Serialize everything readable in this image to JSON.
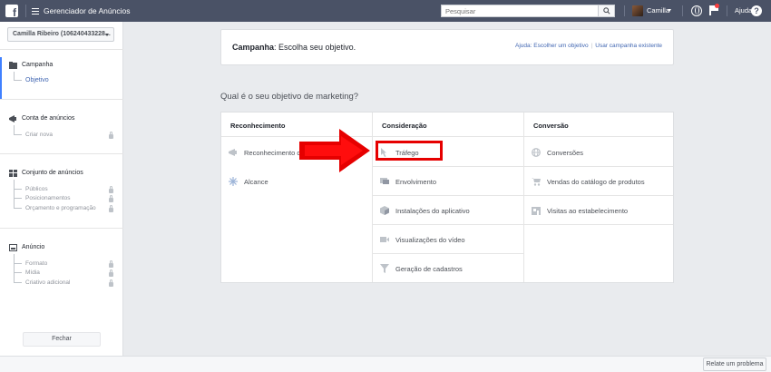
{
  "topbar": {
    "app_title": "Gerenciador de Anúncios",
    "search_placeholder": "Pesquisar",
    "username": "Camilla",
    "help_label": "Ajuda"
  },
  "sidebar": {
    "account": "Camilla Ribeiro (106240433228...",
    "campaign": {
      "title": "Campanha",
      "items": [
        "Objetivo"
      ]
    },
    "ad_account": {
      "title": "Conta de anúncios",
      "items": [
        "Criar nova"
      ]
    },
    "ad_set": {
      "title": "Conjunto de anúncios",
      "items": [
        "Públicos",
        "Posicionamentos",
        "Orçamento e programação"
      ]
    },
    "ad": {
      "title": "Anúncio",
      "items": [
        "Formato",
        "Mídia",
        "Criativo adicional"
      ]
    },
    "close_label": "Fechar"
  },
  "header": {
    "title_bold": "Campanha",
    "title_rest": ": Escolha seu objetivo.",
    "help_link": "Ajuda: Escolher um objetivo",
    "existing_link": "Usar campanha existente"
  },
  "question": "Qual é o seu objetivo de marketing?",
  "columns": [
    {
      "title": "Reconhecimento",
      "items": [
        {
          "label": "Reconhecimento d",
          "icon": "megaphone-icon"
        },
        {
          "label": "Alcance",
          "icon": "burst-icon"
        }
      ]
    },
    {
      "title": "Consideração",
      "items": [
        {
          "label": "Tráfego",
          "icon": "cursor-icon"
        },
        {
          "label": "Envolvimento",
          "icon": "chat-icon"
        },
        {
          "label": "Instalações do aplicativo",
          "icon": "box-icon"
        },
        {
          "label": "Visualizações do vídeo",
          "icon": "video-icon"
        },
        {
          "label": "Geração de cadastros",
          "icon": "funnel-icon"
        }
      ]
    },
    {
      "title": "Conversão",
      "items": [
        {
          "label": "Conversões",
          "icon": "globe-icon"
        },
        {
          "label": "Vendas do catálogo de produtos",
          "icon": "cart-icon"
        },
        {
          "label": "Visitas ao estabelecimento",
          "icon": "store-icon"
        }
      ]
    }
  ],
  "footer": {
    "report_label": "Relate um problema"
  },
  "colors": {
    "topbar": "#4a5266",
    "accent": "#4080ff",
    "link": "#4267b2",
    "highlight": "#e60000"
  }
}
